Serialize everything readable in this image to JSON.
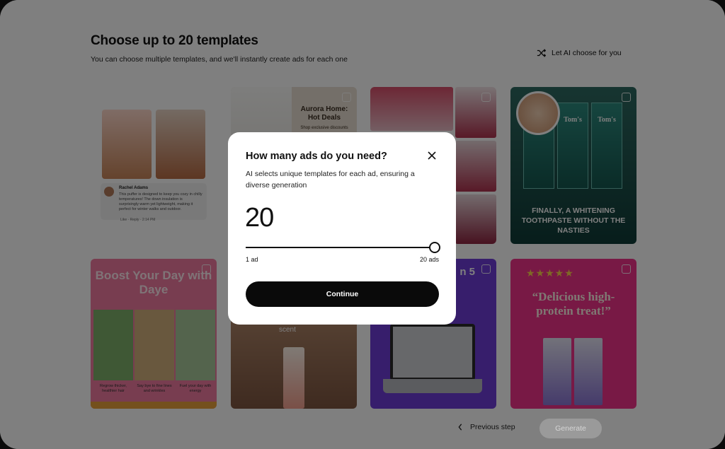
{
  "header": {
    "title": "Choose up to 20 templates",
    "subtitle": "You can choose multiple templates, and we'll instantly create ads for each one",
    "ai_choose_label": "Let AI choose for you"
  },
  "templates": [
    {
      "name": "Rachel Adams",
      "review": "This puffer is designed to keep you cozy in chilly temperatures! The down insulation is surprisingly warm yet lightweight, making it perfect for winter walks and outdoor.",
      "meta": "Like · Reply · 2:14 PM"
    },
    {
      "headline": "Aurora Home: Hot Deals",
      "sub": "Shop exclusive discounts"
    },
    {},
    {
      "brand": "Tom's",
      "quote": "FINALLY, A WHITENING TOOTHPASTE WITHOUT THE NASTIES"
    },
    {
      "headline": "Boost Your Day with Daye",
      "captions": [
        "Regrow thicker, healthier hair",
        "Say bye to fine lines and wrinkles",
        "Fuel your day with energy"
      ]
    },
    {
      "label": "scent"
    },
    {
      "label": "n 5"
    },
    {
      "stars": "★★★★★",
      "quote": "“Delicious high-protein treat!”"
    }
  ],
  "footer": {
    "previous_label": "Previous step",
    "generate_label": "Generate"
  },
  "modal": {
    "title": "How many ads do you need?",
    "description": "AI selects unique templates for each ad, ensuring a diverse generation",
    "count": "20",
    "slider": {
      "min": 1,
      "max": 20,
      "value": 20,
      "min_label": "1 ad",
      "max_label": "20 ads"
    },
    "continue_label": "Continue"
  }
}
